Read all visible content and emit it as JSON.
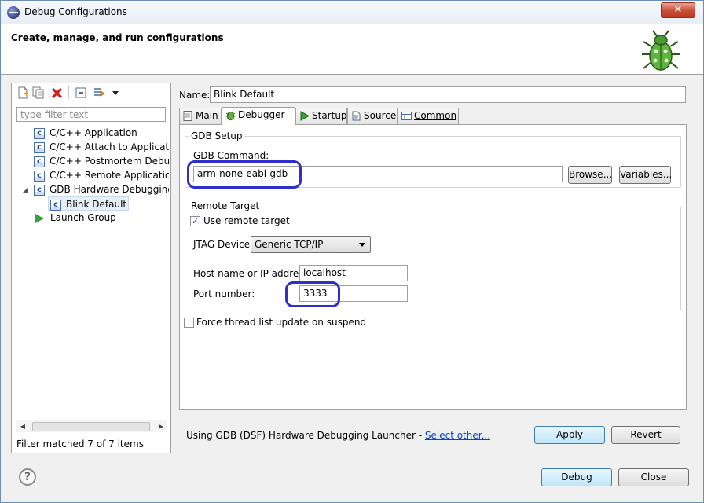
{
  "window": {
    "title": "Debug Configurations"
  },
  "banner": {
    "title": "Create, manage, and run configurations"
  },
  "left_panel": {
    "toolbar_icons": [
      "new-configuration-icon",
      "duplicate-icon",
      "delete-icon",
      "collapse-all-icon",
      "filter-icon",
      "view-menu-chevron-icon"
    ],
    "filter_placeholder": "type filter text",
    "tree": [
      {
        "label": "C/C++ Application",
        "icon": "c-config-icon",
        "level": 1
      },
      {
        "label": "C/C++ Attach to Application",
        "icon": "c-config-icon",
        "level": 1
      },
      {
        "label": "C/C++ Postmortem Debugger",
        "icon": "c-config-icon",
        "level": 1
      },
      {
        "label": "C/C++ Remote Application",
        "icon": "c-config-icon",
        "level": 1
      },
      {
        "label": "GDB Hardware Debugging",
        "icon": "c-config-icon",
        "level": 1,
        "expanded": true
      },
      {
        "label": "Blink Default",
        "icon": "c-config-icon",
        "level": 2,
        "selected": true
      },
      {
        "label": "Launch Group",
        "icon": "launch-group-icon",
        "level": 1
      }
    ],
    "filter_status": "Filter matched 7 of 7 items"
  },
  "name": {
    "label": "Name:",
    "value": "Blink Default"
  },
  "tabs": [
    {
      "label": "Main",
      "icon": "main-tab-icon"
    },
    {
      "label": "Debugger",
      "icon": "debugger-tab-icon",
      "active": true
    },
    {
      "label": "Startup",
      "icon": "startup-tab-icon"
    },
    {
      "label": "Source",
      "icon": "source-tab-icon"
    },
    {
      "label": "Common",
      "icon": "common-tab-icon"
    }
  ],
  "gdb_setup": {
    "title": "GDB Setup",
    "command_label": "GDB Command:",
    "command_value": "arm-none-eabi-gdb",
    "browse_label": "Browse...",
    "variables_label": "Variables..."
  },
  "remote_target": {
    "title": "Remote Target",
    "use_remote_label": "Use remote target",
    "use_remote_checked": true,
    "jtag_label": "JTAG Device:",
    "jtag_value": "Generic TCP/IP",
    "host_label": "Host name or IP address:",
    "host_value": "localhost",
    "port_label": "Port number:",
    "port_value": "3333"
  },
  "force_thread": {
    "label": "Force thread list update on suspend",
    "checked": false
  },
  "launcher": {
    "text": "Using GDB (DSF) Hardware Debugging Launcher - ",
    "link": "Select other..."
  },
  "buttons": {
    "apply": "Apply",
    "revert": "Revert",
    "debug": "Debug",
    "close": "Close"
  },
  "help_symbol": "?",
  "close_symbol": "✕",
  "colors": {
    "highlight_ring": "#3030c8",
    "title_bar": "#e8eef6",
    "close_button": "#c94e36"
  }
}
